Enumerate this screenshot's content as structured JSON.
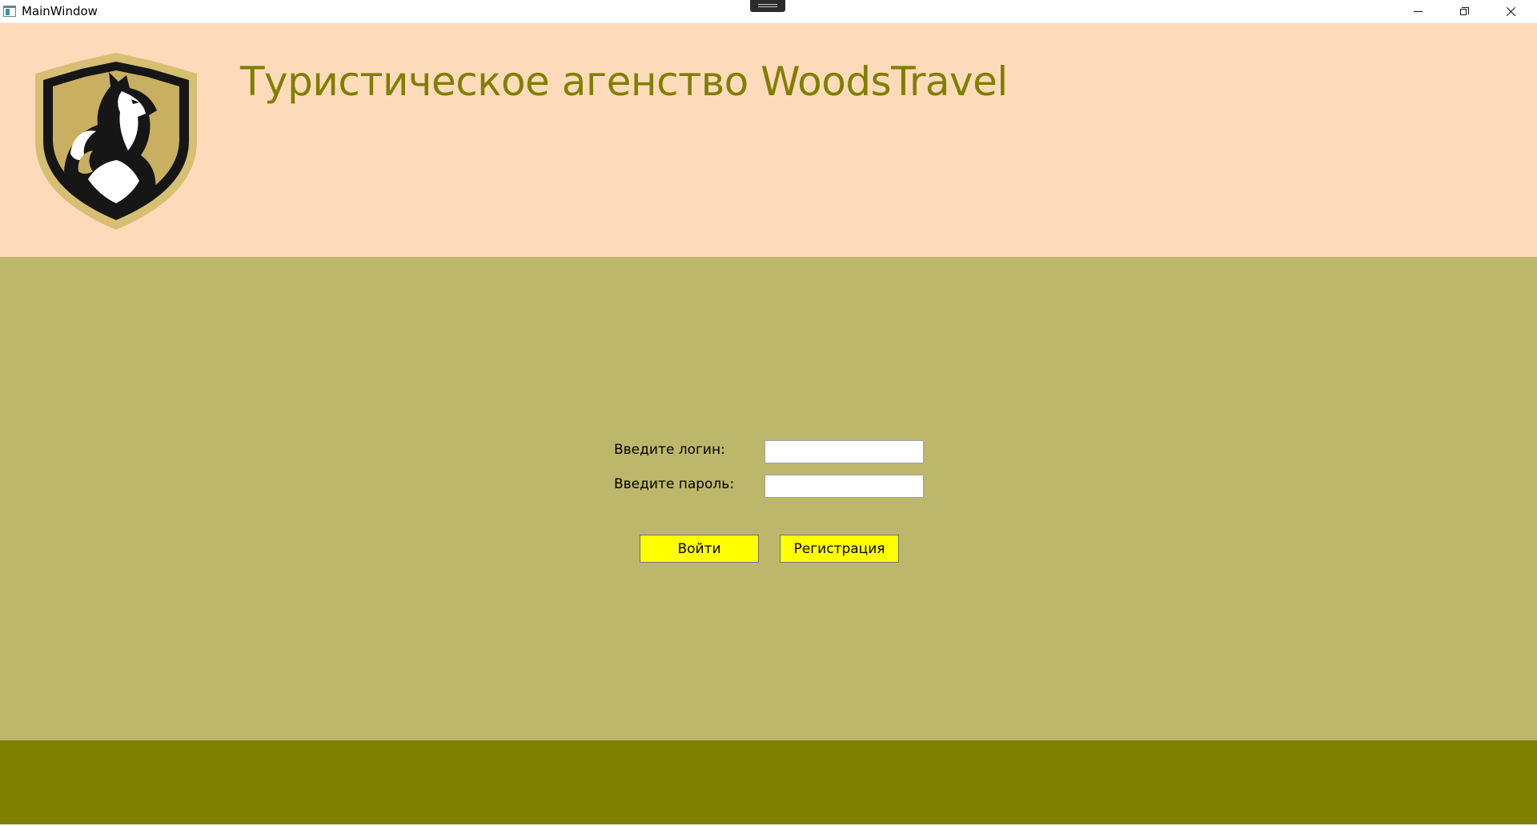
{
  "window": {
    "title": "MainWindow",
    "controls": {
      "minimize": "minimize-icon",
      "maximize": "restore-icon",
      "close": "close-icon"
    }
  },
  "header": {
    "title": "Туристическое агенство WoodsTravel",
    "logo": "wolf-shield-logo",
    "background": "#fddab9",
    "title_color": "#7f7f00"
  },
  "login_form": {
    "login_label": "Введите логин:",
    "login_value": "",
    "password_label": "Введите пароль:",
    "password_value": "",
    "login_button": "Войти",
    "register_button": "Регистрация",
    "button_color": "#ffff00"
  },
  "colors": {
    "main_background": "#bdb76b",
    "footer_background": "#808000"
  }
}
